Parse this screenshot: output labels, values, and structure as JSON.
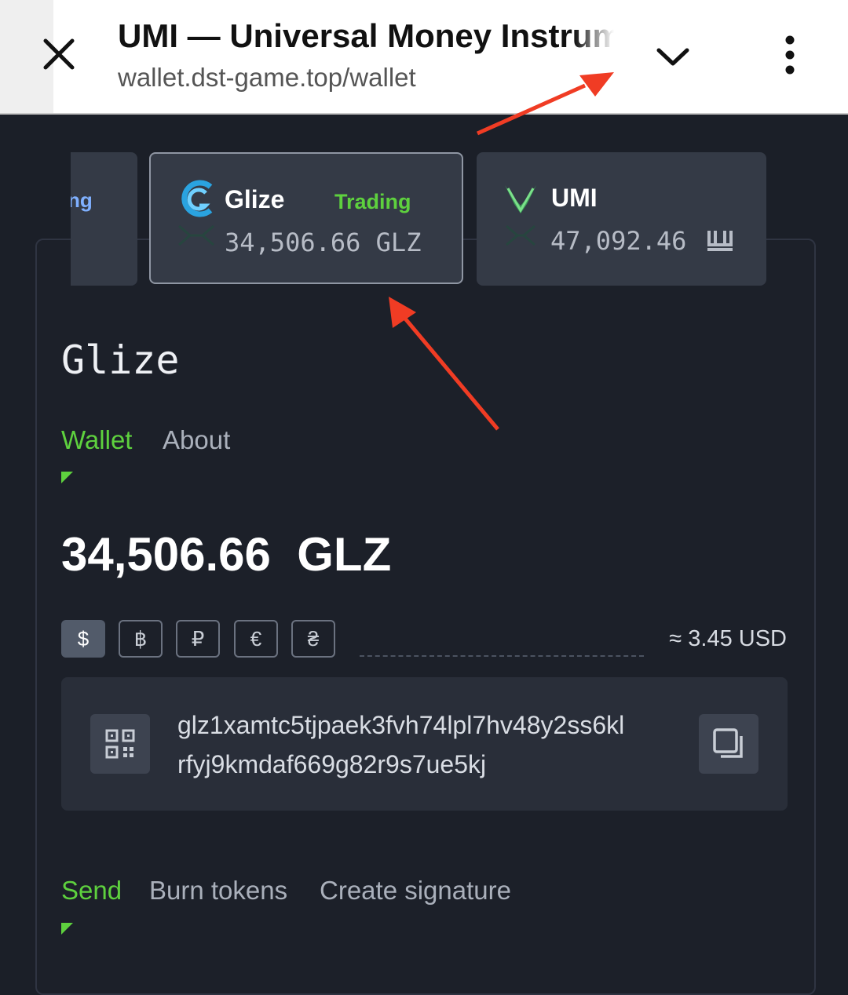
{
  "browser": {
    "title": "UMI — Universal Money Instrument",
    "url": "wallet.dst-game.top/wallet"
  },
  "tokens": {
    "partial_label": "ng",
    "selected": {
      "name": "Glize",
      "badge": "Trading",
      "amount": "34,506.66 GLZ"
    },
    "second": {
      "name": "UMI",
      "amount": "47,092.46"
    }
  },
  "main": {
    "title": "Glize",
    "tabs": [
      "Wallet",
      "About"
    ],
    "balance": "34,506.66  GLZ",
    "currencies": [
      "$",
      "฿",
      "₽",
      "€",
      "₴"
    ],
    "usd_value": "≈ 3.45 USD",
    "address_line1": "glz1xamtc5tjpaek3fvh74lpl7hv48y2ss6kl",
    "address_line2": "rfyj9kmdaf669g82r9s7ue5kj",
    "action_tabs": [
      "Send",
      "Burn tokens",
      "Create signature"
    ]
  },
  "colors": {
    "accent_green": "#5ed13e",
    "annotation_red": "#f03c24",
    "background": "#1b1f28"
  },
  "icons": [
    "close-icon",
    "chevron-down-icon",
    "more-vert-icon",
    "glize-logo-icon",
    "umi-logo-icon",
    "qr-code-icon",
    "copy-icon"
  ]
}
